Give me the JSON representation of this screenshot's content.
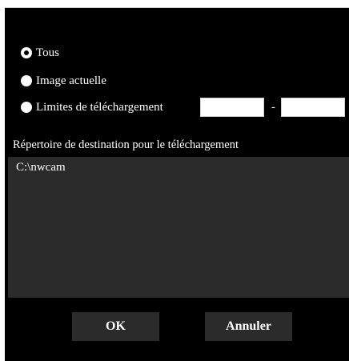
{
  "options": {
    "all_label": "Tous",
    "current_image_label": "Image actuelle",
    "download_limits_label": "Limites de téléchargement",
    "range_from_value": "",
    "range_to_value": "",
    "range_separator": "-",
    "selected": "all"
  },
  "destination": {
    "label": "Répertoire de destination pour le téléchargement",
    "path": "C:\\nwcam"
  },
  "buttons": {
    "ok_label": "OK",
    "cancel_label": "Annuler"
  }
}
